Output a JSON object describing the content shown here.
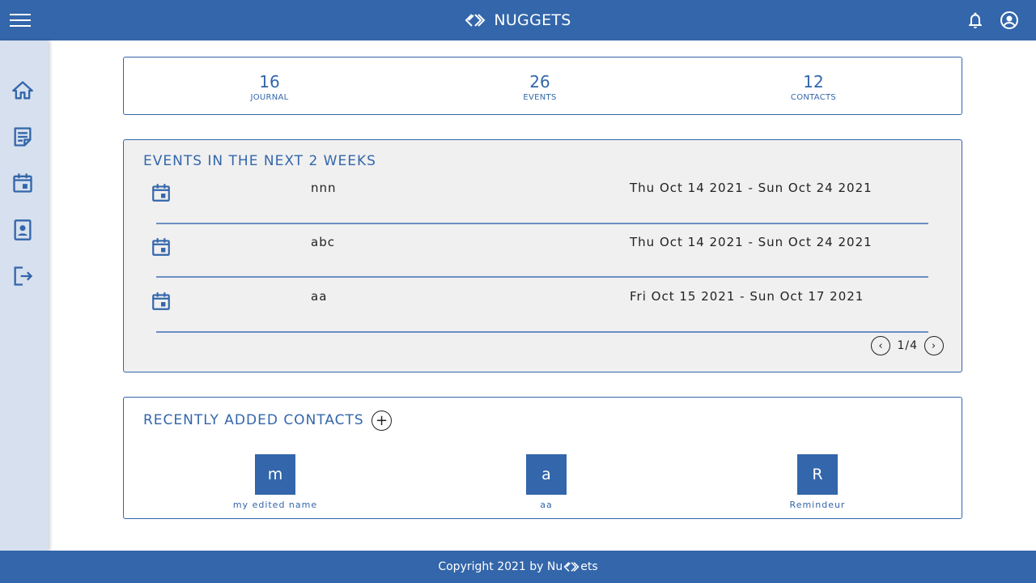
{
  "header": {
    "title": "NUGGETS",
    "icons": [
      "menu-icon",
      "nuggets-logo-icon",
      "bell-icon",
      "account-icon"
    ]
  },
  "sidebar": {
    "items": [
      {
        "name": "home",
        "icon": "home-icon"
      },
      {
        "name": "journal",
        "icon": "note-icon"
      },
      {
        "name": "events",
        "icon": "calendar-icon"
      },
      {
        "name": "contacts",
        "icon": "contact-card-icon"
      },
      {
        "name": "logout",
        "icon": "logout-icon"
      }
    ]
  },
  "stats": [
    {
      "value": "16",
      "label": "JOURNAL"
    },
    {
      "value": "26",
      "label": "EVENTS"
    },
    {
      "value": "12",
      "label": "CONTACTS"
    }
  ],
  "events": {
    "title": "EVENTS IN THE NEXT 2 WEEKS",
    "items": [
      {
        "name": "nnn",
        "dates": "Thu Oct 14 2021 - Sun Oct 24 2021"
      },
      {
        "name": "abc",
        "dates": "Thu Oct 14 2021 - Sun Oct 24 2021"
      },
      {
        "name": "aa",
        "dates": "Fri Oct 15 2021 - Sun Oct 17 2021"
      }
    ],
    "pager": {
      "prev": "‹",
      "label": "1/4",
      "next": "›"
    }
  },
  "contacts": {
    "title": "RECENTLY ADDED CONTACTS",
    "add_label": "+",
    "items": [
      {
        "initial": "m",
        "name": "my edited name"
      },
      {
        "initial": "a",
        "name": "aa"
      },
      {
        "initial": "R",
        "name": "Remindeur"
      }
    ]
  },
  "footer": {
    "prefix": "Copyright 2021 by Nu",
    "suffix": "ets"
  },
  "colors": {
    "primary": "#3366aa",
    "sidebar_bg": "#d6e0ee",
    "events_bg": "#f0f0f0"
  }
}
